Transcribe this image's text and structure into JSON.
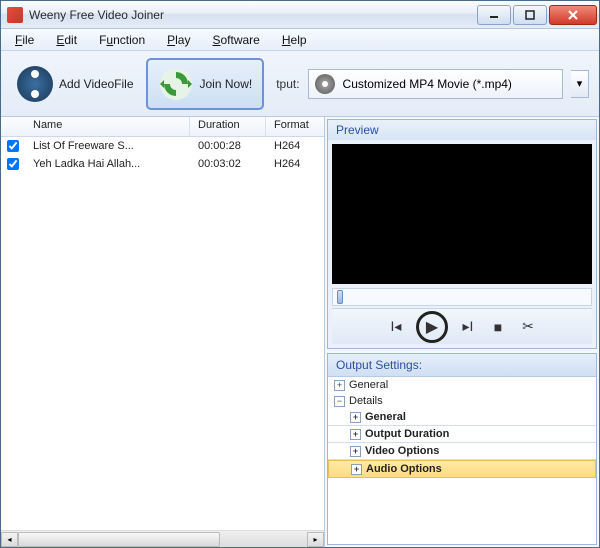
{
  "window": {
    "title": "Weeny Free Video Joiner"
  },
  "menu": {
    "file": "File",
    "edit": "Edit",
    "function": "Function",
    "play": "Play",
    "software": "Software",
    "help": "Help"
  },
  "toolbar": {
    "add_label": "Add VideoFile",
    "join_label": "Join Now!",
    "output_label": "tput:",
    "output_combo": "Customized MP4 Movie (*.mp4)"
  },
  "list": {
    "headers": {
      "name": "Name",
      "duration": "Duration",
      "format": "Format"
    },
    "rows": [
      {
        "checked": true,
        "name": "List Of Freeware S...",
        "duration": "00:00:28",
        "format": "H264"
      },
      {
        "checked": true,
        "name": "Yeh Ladka Hai Allah...",
        "duration": "00:03:02",
        "format": "H264"
      }
    ]
  },
  "preview": {
    "title": "Preview"
  },
  "output_settings": {
    "title": "Output Settings:",
    "nodes": {
      "general_top": "General",
      "details": "Details",
      "general": "General",
      "output_duration": "Output Duration",
      "video_options": "Video Options",
      "audio_options": "Audio Options"
    }
  }
}
